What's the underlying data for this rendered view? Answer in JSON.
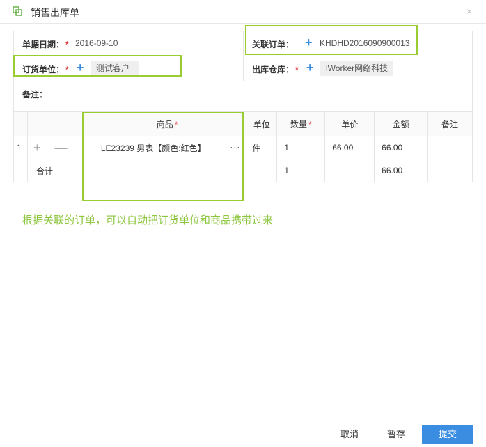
{
  "dialog": {
    "title": "销售出库单",
    "close_label": "×"
  },
  "form": {
    "date_label": "单据日期：",
    "date_value": "2016-09-10",
    "order_label": "关联订单：",
    "order_value": "KHDHD2016090900013",
    "unit_label": "订货单位：",
    "unit_value": "测试客户",
    "warehouse_label": "出库仓库：",
    "warehouse_value": "iWorker网络科技",
    "note_label": "备注：",
    "required_mark": "*",
    "plus": "+"
  },
  "grid": {
    "columns": {
      "product": "商品",
      "unit": "单位",
      "qty": "数量",
      "price": "单价",
      "amount": "金额",
      "note": "备注"
    },
    "row": {
      "index": "1",
      "add": "+",
      "remove": "—",
      "product": "LE23239 男表【颜色:红色】",
      "more": "···",
      "unit": "件",
      "qty": "1",
      "price": "66.00",
      "amount": "66.00",
      "note": ""
    },
    "total": {
      "label": "合计",
      "qty": "1",
      "amount": "66.00"
    }
  },
  "annotation": {
    "text": "根据关联的订单，可以自动把订货单位和商品携带过来",
    "highlight_color": "#9acd32"
  },
  "footer": {
    "cancel": "取消",
    "save_draft": "暂存",
    "submit": "提交"
  },
  "colors": {
    "accent": "#3a8de0",
    "required": "#e4393c",
    "annotation": "#8dc63f"
  }
}
